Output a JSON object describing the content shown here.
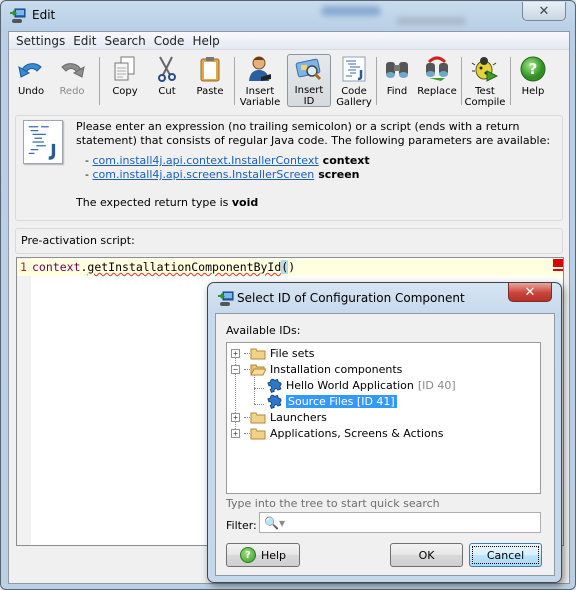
{
  "window": {
    "title": "Edit",
    "close_label": "✕"
  },
  "menubar": {
    "items": [
      "Settings",
      "Edit",
      "Search",
      "Code",
      "Help"
    ]
  },
  "toolbar": {
    "buttons": [
      {
        "id": "undo",
        "label": "Undo",
        "icon": "undo-icon"
      },
      {
        "id": "redo",
        "label": "Redo",
        "icon": "redo-icon",
        "disabled": true
      },
      {
        "id": "copy",
        "label": "Copy",
        "icon": "copy-icon"
      },
      {
        "id": "cut",
        "label": "Cut",
        "icon": "scissors-icon"
      },
      {
        "id": "paste",
        "label": "Paste",
        "icon": "clipboard-icon"
      },
      {
        "id": "insert_variable",
        "label_line1": "Insert",
        "label_line2": "Variable",
        "icon": "user-icon"
      },
      {
        "id": "insert_id",
        "label_line1": "Insert",
        "label_line2": "ID",
        "icon": "id-card-search-icon",
        "active": true
      },
      {
        "id": "code_gallery",
        "label_line1": "Code",
        "label_line2": "Gallery",
        "icon": "code-gallery-icon"
      },
      {
        "id": "find",
        "label": "Find",
        "icon": "binoculars-icon"
      },
      {
        "id": "replace",
        "label": "Replace",
        "icon": "binoculars-replace-icon"
      },
      {
        "id": "test_compile",
        "label_line1": "Test",
        "label_line2": "Compile",
        "icon": "bug-play-icon"
      },
      {
        "id": "help",
        "label": "Help",
        "icon": "help-icon"
      }
    ]
  },
  "info": {
    "description": "Please enter an expression (no trailing semicolon) or a script (ends with a return statement) that consists of regular Java code. The following parameters are available:",
    "params": [
      {
        "type": "com.install4j.api.context.InstallerContext",
        "name": "context"
      },
      {
        "type": "com.install4j.api.screens.InstallerScreen",
        "name": "screen"
      }
    ],
    "return_prefix": "The expected return type is ",
    "return_type": "void"
  },
  "script": {
    "label": "Pre-activation script:",
    "line_number": "1",
    "code_object": "context",
    "code_dot": ".",
    "code_method": "getInstallationComponentById",
    "code_open_paren": "(",
    "code_close_paren": ")"
  },
  "dialog": {
    "title": "Select ID of Configuration Component",
    "close_label": "✕",
    "available_label": "Available IDs:",
    "tree": [
      {
        "label": "File sets",
        "expander": "+",
        "level": 0
      },
      {
        "label": "Installation components",
        "expander": "−",
        "level": 0,
        "expanded": true
      },
      {
        "label": "Hello World Application",
        "id_text": "[ID 40]",
        "level": 1
      },
      {
        "label": "Source Files [ID 41]",
        "level": 1,
        "selected": true
      },
      {
        "label": "Launchers",
        "expander": "+",
        "level": 0
      },
      {
        "label": "Applications, Screens & Actions",
        "expander": "+",
        "level": 0
      }
    ],
    "quick_search_hint": "Type into the tree to start quick search",
    "filter_label": "Filter:",
    "filter_value": "",
    "filter_icon": "🔍▾",
    "help_label": "Help",
    "ok_label": "OK",
    "cancel_label": "Cancel"
  }
}
